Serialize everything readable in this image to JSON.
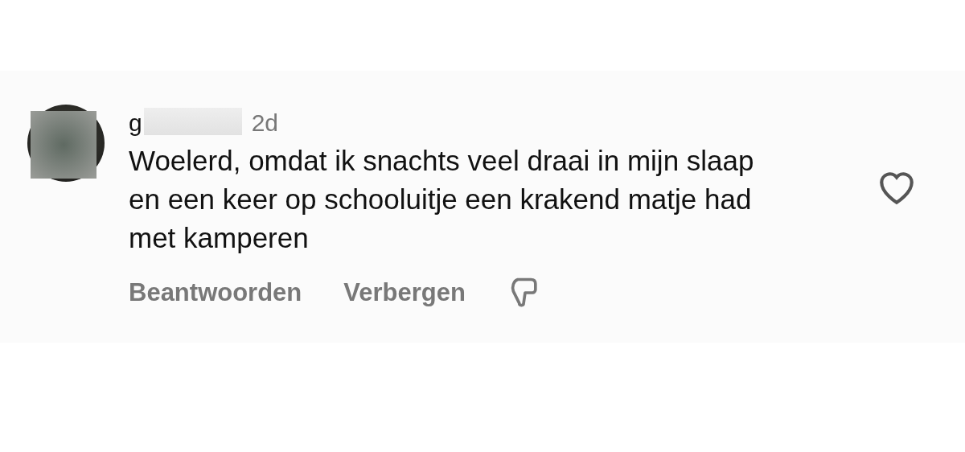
{
  "comment": {
    "username": "g",
    "time": "2d",
    "text": "Woelerd, omdat ik snachts veel draai in mijn slaap en een keer op schooluitje een krakend matje had met kamperen",
    "liked": false,
    "actions": [
      "Beantwoorden",
      "Verbergen"
    ]
  }
}
